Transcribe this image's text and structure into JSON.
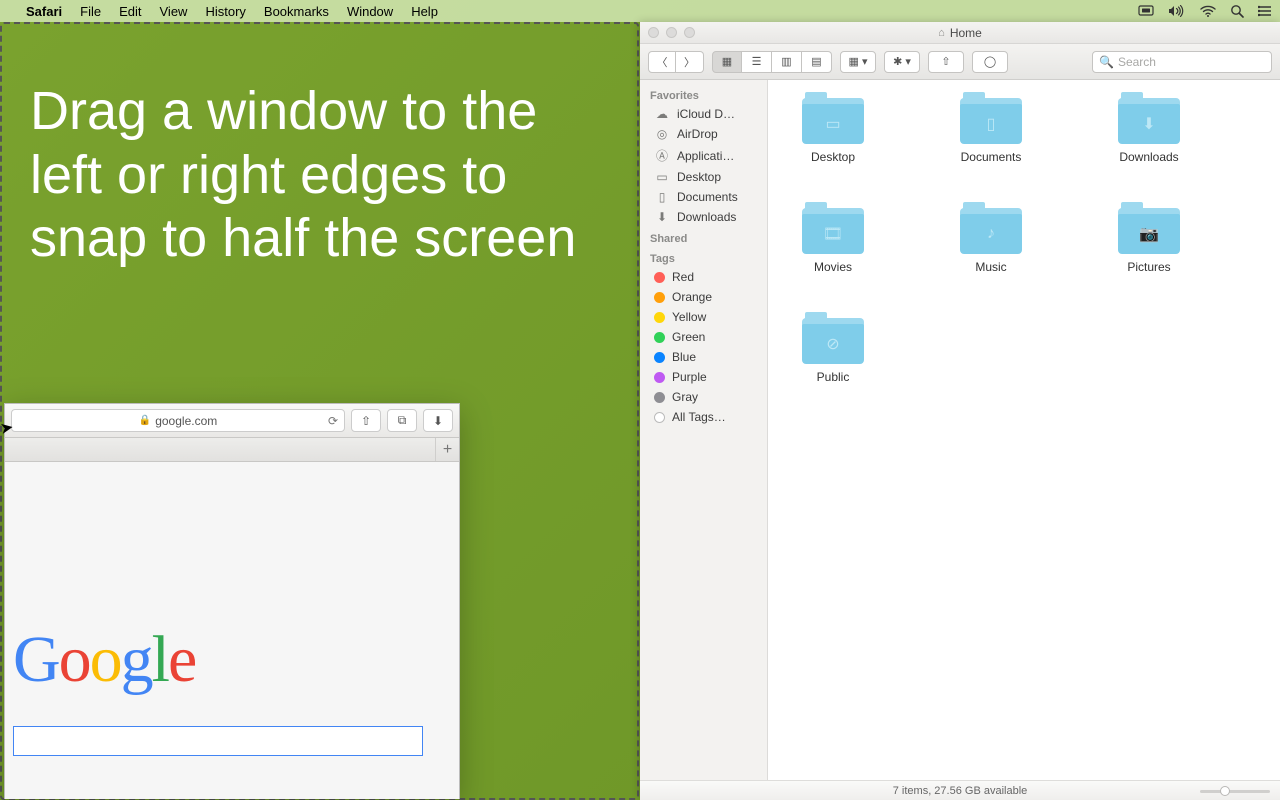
{
  "menubar": {
    "appname": "Safari",
    "items": [
      "File",
      "Edit",
      "View",
      "History",
      "Bookmarks",
      "Window",
      "Help"
    ]
  },
  "overlay": {
    "text": "Drag a window to the left or right edges to snap to half the screen"
  },
  "safari": {
    "url": "google.com",
    "tab_add": "+",
    "logo": {
      "c1": "G",
      "c2": "o",
      "c3": "o",
      "c4": "g",
      "c5": "l",
      "c6": "e"
    }
  },
  "finder": {
    "title": "Home",
    "search_placeholder": "Search",
    "sidebar": {
      "favorites_head": "Favorites",
      "favorites": [
        {
          "icon": "cloud",
          "label": "iCloud D…"
        },
        {
          "icon": "airdrop",
          "label": "AirDrop"
        },
        {
          "icon": "app",
          "label": "Applicati…"
        },
        {
          "icon": "desktop",
          "label": "Desktop"
        },
        {
          "icon": "doc",
          "label": "Documents"
        },
        {
          "icon": "down",
          "label": "Downloads"
        }
      ],
      "shared_head": "Shared",
      "tags_head": "Tags",
      "tags": [
        {
          "color": "#ff5f57",
          "label": "Red"
        },
        {
          "color": "#ff9f0a",
          "label": "Orange"
        },
        {
          "color": "#ffd60a",
          "label": "Yellow"
        },
        {
          "color": "#30d158",
          "label": "Green"
        },
        {
          "color": "#0a84ff",
          "label": "Blue"
        },
        {
          "color": "#bf5af2",
          "label": "Purple"
        },
        {
          "color": "#8e8e93",
          "label": "Gray"
        }
      ],
      "all_tags": "All Tags…"
    },
    "folders": [
      {
        "label": "Desktop",
        "glyph": "▭"
      },
      {
        "label": "Documents",
        "glyph": "▯"
      },
      {
        "label": "Downloads",
        "glyph": "⬇"
      },
      {
        "label": "Movies",
        "glyph": "🎞"
      },
      {
        "label": "Music",
        "glyph": "♪"
      },
      {
        "label": "Pictures",
        "glyph": "📷"
      },
      {
        "label": "Public",
        "glyph": "⊘"
      }
    ],
    "status": "7 items, 27.56 GB available"
  }
}
